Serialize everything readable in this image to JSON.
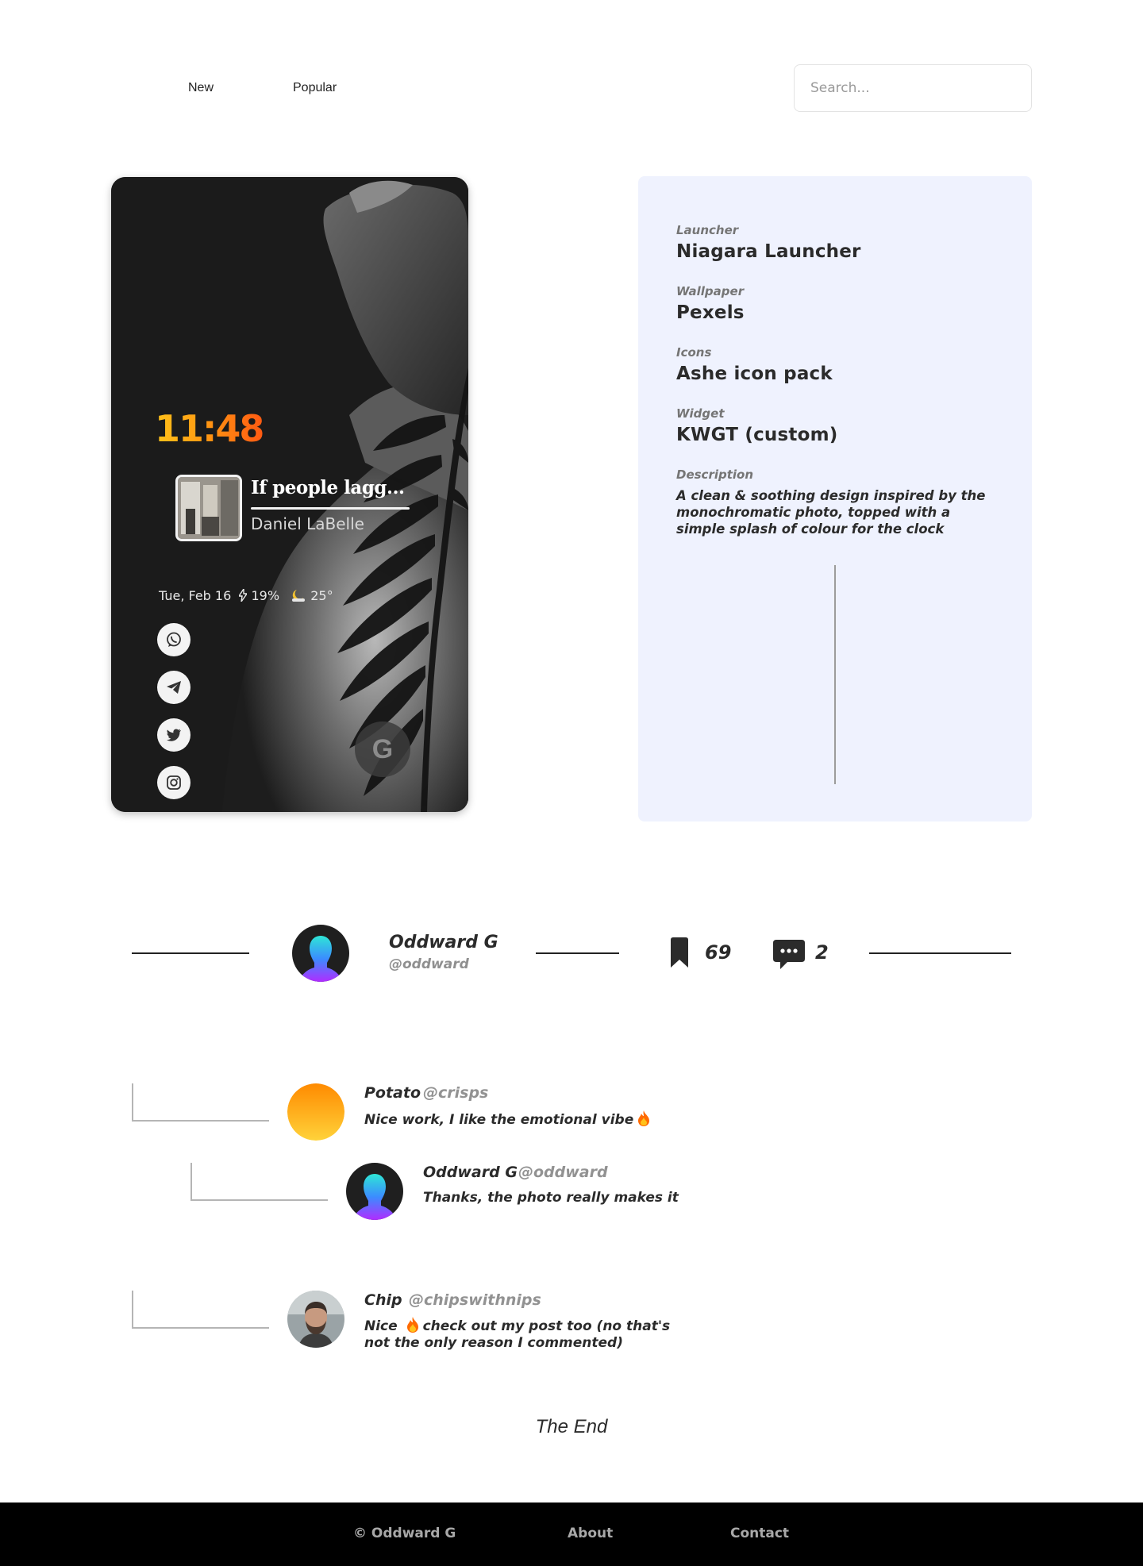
{
  "nav": {
    "new_label": "New",
    "popular_label": "Popular"
  },
  "search": {
    "placeholder": "Search..."
  },
  "phone": {
    "clock": "11:48",
    "media_title": "If people lagg...",
    "media_artist": "Daniel LaBelle",
    "date": "Tue, Feb 16",
    "battery": "19%",
    "temperature": "25°",
    "apps": [
      "whatsapp-icon",
      "telegram-icon",
      "twitter-icon",
      "instagram-icon"
    ],
    "search_glyph": "G",
    "clock_colors": [
      "#ffc21a",
      "#ff5a12"
    ]
  },
  "info": {
    "launcher_label": "Launcher",
    "launcher_value": "Niagara Launcher",
    "wallpaper_label": "Wallpaper",
    "wallpaper_value": "Pexels",
    "icons_label": "Icons",
    "icons_value": "Ashe icon pack",
    "widget_label": "Widget",
    "widget_value": "KWGT (custom)",
    "description_label": "Description",
    "description_value": "A clean & soothing design inspired by the monochromatic photo, topped with a simple splash of colour for the clock",
    "background": "#eff2fe"
  },
  "author": {
    "name": "Oddward G",
    "handle": "@oddward",
    "bookmarks": "69",
    "comments": "2"
  },
  "comments": [
    {
      "name": "Potato",
      "handle": "@crisps",
      "text": "Nice work, I like the emotional vibe"
    },
    {
      "name": "Oddward G",
      "handle": "@oddward",
      "text": "Thanks, the photo really makes it"
    },
    {
      "name": "Chip",
      "handle": "@chipswithnips",
      "text_before": "Nice",
      "text_after": "check out my post too (no that's not the only reason I commented)"
    }
  ],
  "the_end": "The End",
  "footer": {
    "copyright": "© Oddward G",
    "about": "About",
    "contact": "Contact"
  }
}
